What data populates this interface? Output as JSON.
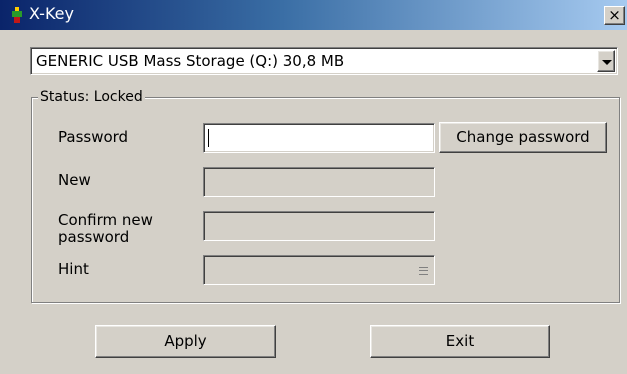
{
  "window": {
    "title": "X-Key",
    "close_glyph": "×"
  },
  "device": {
    "selected": "GENERIC USB Mass Storage (Q:) 30,8 MB"
  },
  "status": {
    "label": "Status: Locked"
  },
  "form": {
    "password_label": "Password",
    "password_value": "",
    "new_label": "New",
    "confirm_label_line1": "Confirm new",
    "confirm_label_line2": "password",
    "hint_label": "Hint",
    "change_password_button": "Change password"
  },
  "buttons": {
    "apply": "Apply",
    "exit": "Exit"
  }
}
